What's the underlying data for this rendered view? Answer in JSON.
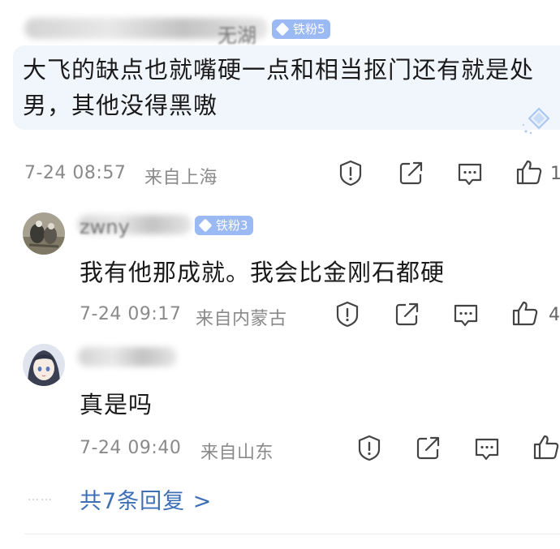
{
  "comment": {
    "badge": "铁粉5",
    "text": "大飞的缺点也就嘴硬一点和相当抠门还有就是处男，其他没得黑嗷",
    "time": "7-24 08:57",
    "location": "来自上海",
    "like_count": "1"
  },
  "replies": [
    {
      "username_partial": "zwny",
      "badge": "铁粉3",
      "text": "我有他那成就。我会比金刚石都硬",
      "time": "7-24 09:17",
      "location": "来自内蒙古",
      "like_count": "4"
    },
    {
      "text": "真是吗",
      "time": "7-24 09:40",
      "location": "来自山东"
    }
  ],
  "more_replies": "共7条回复 >",
  "more_dots": "……",
  "icons": [
    "report-icon",
    "share-icon",
    "comment-icon",
    "like-icon"
  ],
  "colors": {
    "badge": "#9bb9f2",
    "link": "#3d6fb6",
    "bubble": "#f1f5fc",
    "meta": "#8a8a8a"
  }
}
